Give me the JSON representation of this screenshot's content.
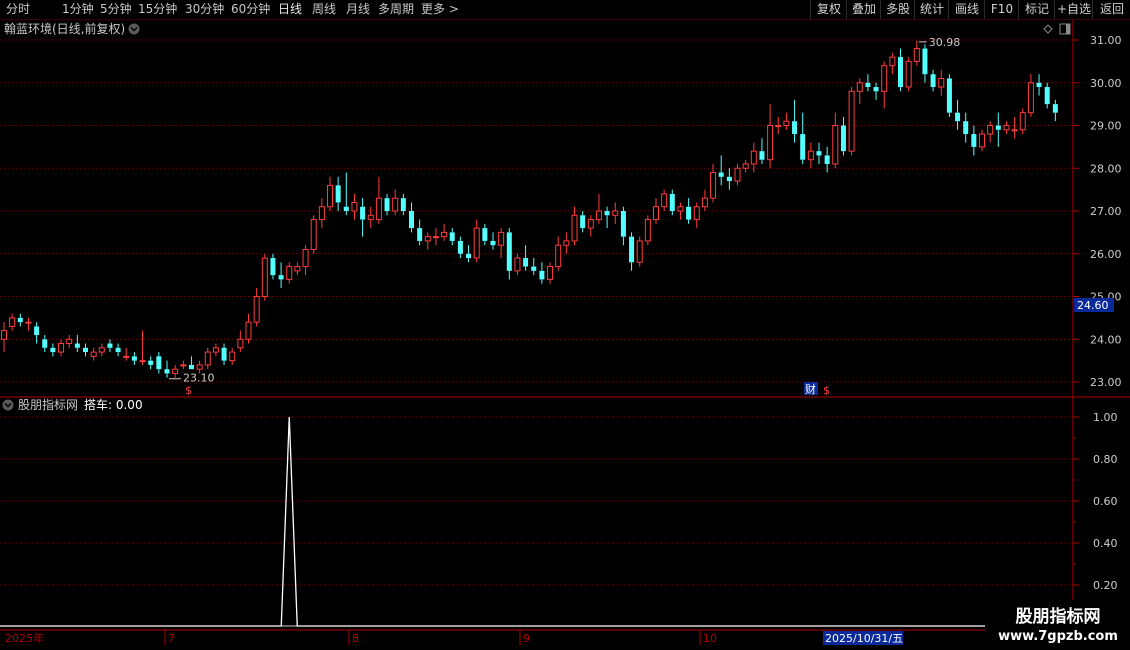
{
  "toolbar": {
    "periods": [
      {
        "label": "分时",
        "active": false
      },
      {
        "label": "1分钟",
        "active": false
      },
      {
        "label": "5分钟",
        "active": false
      },
      {
        "label": "15分钟",
        "active": false
      },
      {
        "label": "30分钟",
        "active": false
      },
      {
        "label": "60分钟",
        "active": false
      },
      {
        "label": "日线",
        "active": true
      },
      {
        "label": "周线",
        "active": false
      },
      {
        "label": "月线",
        "active": false
      },
      {
        "label": "多周期",
        "active": false
      },
      {
        "label": "更多 >",
        "active": false
      }
    ],
    "right_buttons": [
      "复权",
      "叠加",
      "多股",
      "统计",
      "画线",
      "F10",
      "标记",
      "+自选",
      "返回"
    ]
  },
  "colors": {
    "up": "#ff3c3c",
    "down": "#54ffff",
    "grid": "#7a0000",
    "axis": "#b00000",
    "price_tag_bg": "#0a2a9a",
    "date_tag_bg": "#0a2a9a",
    "text_yellow": "#d8c800"
  },
  "price_panel": {
    "title": "翰蓝环境(日线,前复权)",
    "high_marker": "30.98",
    "low_marker": "23.10",
    "current_price_tag": "24.60",
    "event_marker": "财",
    "dollar_marker": "$",
    "y_ticks": [
      "31.00",
      "30.00",
      "29.00",
      "28.00",
      "27.00",
      "26.00",
      "25.00",
      "24.00",
      "23.00"
    ]
  },
  "indicator_panel": {
    "title": "股朋指标网",
    "series_label": "搭车: 0.00",
    "y_ticks": [
      "1.00",
      "0.80",
      "0.60",
      "0.40",
      "0.20"
    ]
  },
  "time_axis": {
    "labels": [
      "2025年",
      "7",
      "8",
      "9",
      "10"
    ],
    "cursor_date": "2025/10/31/五"
  },
  "watermark": {
    "title": "股朋指标网",
    "url": "www.7gpzb.com"
  },
  "chart_data": [
    {
      "type": "candlestick",
      "title": "翰蓝环境(日线,前复权)",
      "ylim": [
        22.8,
        31.3
      ],
      "x_ticks": [
        "2025年",
        "7",
        "8",
        "9",
        "10"
      ],
      "ohlc": [
        [
          24.0,
          24.4,
          23.7,
          24.2
        ],
        [
          24.3,
          24.6,
          24.2,
          24.5
        ],
        [
          24.5,
          24.6,
          24.3,
          24.4
        ],
        [
          24.4,
          24.5,
          24.2,
          24.4
        ],
        [
          24.3,
          24.4,
          23.9,
          24.1
        ],
        [
          24.0,
          24.1,
          23.7,
          23.8
        ],
        [
          23.8,
          23.9,
          23.6,
          23.7
        ],
        [
          23.7,
          24.0,
          23.6,
          23.9
        ],
        [
          23.9,
          24.1,
          23.8,
          24.0
        ],
        [
          23.9,
          24.1,
          23.7,
          23.8
        ],
        [
          23.8,
          23.9,
          23.6,
          23.7
        ],
        [
          23.6,
          23.8,
          23.5,
          23.7
        ],
        [
          23.7,
          23.9,
          23.6,
          23.8
        ],
        [
          23.9,
          24.0,
          23.7,
          23.8
        ],
        [
          23.8,
          23.9,
          23.6,
          23.7
        ],
        [
          23.6,
          23.8,
          23.5,
          23.6
        ],
        [
          23.6,
          23.7,
          23.4,
          23.5
        ],
        [
          23.5,
          24.2,
          23.4,
          23.5
        ],
        [
          23.5,
          23.6,
          23.3,
          23.4
        ],
        [
          23.6,
          23.7,
          23.2,
          23.3
        ],
        [
          23.3,
          23.5,
          23.1,
          23.2
        ],
        [
          23.2,
          23.4,
          23.1,
          23.3
        ],
        [
          23.4,
          23.5,
          23.3,
          23.4
        ],
        [
          23.4,
          23.6,
          23.3,
          23.3
        ],
        [
          23.3,
          23.5,
          23.2,
          23.4
        ],
        [
          23.4,
          23.8,
          23.3,
          23.7
        ],
        [
          23.7,
          23.9,
          23.6,
          23.8
        ],
        [
          23.8,
          23.9,
          23.4,
          23.5
        ],
        [
          23.5,
          23.8,
          23.4,
          23.7
        ],
        [
          23.8,
          24.2,
          23.7,
          24.0
        ],
        [
          24.0,
          24.6,
          23.9,
          24.4
        ],
        [
          24.4,
          25.2,
          24.3,
          25.0
        ],
        [
          25.0,
          26.0,
          24.9,
          25.9
        ],
        [
          25.9,
          26.0,
          25.4,
          25.5
        ],
        [
          25.5,
          25.8,
          25.2,
          25.4
        ],
        [
          25.4,
          25.8,
          25.3,
          25.7
        ],
        [
          25.6,
          25.8,
          25.5,
          25.7
        ],
        [
          25.7,
          26.2,
          25.5,
          26.1
        ],
        [
          26.1,
          26.9,
          26.0,
          26.8
        ],
        [
          26.8,
          27.3,
          26.6,
          27.1
        ],
        [
          27.1,
          27.8,
          27.0,
          27.6
        ],
        [
          27.6,
          27.8,
          27.0,
          27.2
        ],
        [
          27.1,
          27.9,
          26.9,
          27.0
        ],
        [
          27.0,
          27.4,
          26.8,
          27.2
        ],
        [
          27.1,
          27.3,
          26.4,
          26.8
        ],
        [
          26.8,
          27.1,
          26.6,
          26.9
        ],
        [
          26.8,
          27.8,
          26.7,
          27.3
        ],
        [
          27.3,
          27.4,
          26.9,
          27.0
        ],
        [
          27.0,
          27.5,
          26.9,
          27.3
        ],
        [
          27.3,
          27.4,
          26.9,
          27.0
        ],
        [
          27.0,
          27.2,
          26.5,
          26.6
        ],
        [
          26.6,
          26.8,
          26.2,
          26.3
        ],
        [
          26.3,
          26.5,
          26.1,
          26.4
        ],
        [
          26.4,
          26.6,
          26.2,
          26.4
        ],
        [
          26.4,
          26.7,
          26.3,
          26.5
        ],
        [
          26.5,
          26.6,
          26.2,
          26.3
        ],
        [
          26.3,
          26.4,
          25.9,
          26.0
        ],
        [
          26.0,
          26.2,
          25.8,
          25.9
        ],
        [
          25.9,
          26.8,
          25.8,
          26.6
        ],
        [
          26.6,
          26.7,
          26.2,
          26.3
        ],
        [
          26.3,
          26.5,
          26.1,
          26.2
        ],
        [
          26.2,
          26.6,
          25.9,
          26.5
        ],
        [
          26.5,
          26.6,
          25.4,
          25.6
        ],
        [
          25.6,
          26.0,
          25.5,
          25.9
        ],
        [
          25.9,
          26.2,
          25.6,
          25.7
        ],
        [
          25.7,
          25.9,
          25.5,
          25.6
        ],
        [
          25.6,
          25.8,
          25.3,
          25.4
        ],
        [
          25.4,
          25.8,
          25.3,
          25.7
        ],
        [
          25.7,
          26.4,
          25.6,
          26.2
        ],
        [
          26.2,
          26.5,
          26.0,
          26.3
        ],
        [
          26.3,
          27.1,
          26.2,
          26.9
        ],
        [
          26.9,
          27.0,
          26.5,
          26.6
        ],
        [
          26.6,
          26.9,
          26.4,
          26.8
        ],
        [
          26.8,
          27.4,
          26.7,
          27.0
        ],
        [
          27.0,
          27.1,
          26.6,
          26.9
        ],
        [
          26.9,
          27.2,
          26.7,
          27.0
        ],
        [
          27.0,
          27.1,
          26.2,
          26.4
        ],
        [
          26.4,
          26.5,
          25.6,
          25.8
        ],
        [
          25.8,
          26.4,
          25.7,
          26.3
        ],
        [
          26.3,
          26.9,
          26.2,
          26.8
        ],
        [
          26.8,
          27.3,
          26.7,
          27.1
        ],
        [
          27.1,
          27.5,
          27.0,
          27.4
        ],
        [
          27.4,
          27.5,
          26.9,
          27.0
        ],
        [
          27.0,
          27.2,
          26.8,
          27.1
        ],
        [
          27.1,
          27.3,
          26.7,
          26.8
        ],
        [
          26.8,
          27.2,
          26.6,
          27.1
        ],
        [
          27.1,
          27.5,
          27.0,
          27.3
        ],
        [
          27.3,
          28.1,
          27.2,
          27.9
        ],
        [
          27.9,
          28.3,
          27.6,
          27.8
        ],
        [
          27.8,
          28.0,
          27.5,
          27.7
        ],
        [
          27.7,
          28.1,
          27.6,
          28.0
        ],
        [
          28.0,
          28.2,
          27.9,
          28.1
        ],
        [
          28.1,
          28.6,
          27.9,
          28.4
        ],
        [
          28.4,
          28.7,
          28.1,
          28.2
        ],
        [
          28.2,
          29.5,
          28.0,
          29.0
        ],
        [
          29.0,
          29.2,
          28.8,
          29.0
        ],
        [
          29.0,
          29.3,
          28.9,
          29.1
        ],
        [
          29.1,
          29.6,
          28.6,
          28.8
        ],
        [
          28.8,
          29.3,
          28.1,
          28.2
        ],
        [
          28.2,
          28.6,
          28.0,
          28.4
        ],
        [
          28.4,
          28.6,
          28.1,
          28.3
        ],
        [
          28.3,
          28.5,
          27.9,
          28.1
        ],
        [
          28.1,
          29.3,
          28.0,
          29.0
        ],
        [
          29.0,
          29.2,
          28.3,
          28.4
        ],
        [
          28.4,
          29.9,
          28.3,
          29.8
        ],
        [
          29.8,
          30.1,
          29.5,
          30.0
        ],
        [
          30.0,
          30.2,
          29.8,
          29.9
        ],
        [
          29.9,
          30.0,
          29.6,
          29.8
        ],
        [
          29.8,
          30.5,
          29.4,
          30.4
        ],
        [
          30.4,
          30.7,
          30.2,
          30.6
        ],
        [
          30.6,
          30.8,
          29.8,
          29.9
        ],
        [
          29.9,
          30.6,
          29.8,
          30.5
        ],
        [
          30.5,
          30.98,
          30.4,
          30.8
        ],
        [
          30.8,
          30.9,
          30.0,
          30.2
        ],
        [
          30.2,
          30.3,
          29.8,
          29.9
        ],
        [
          29.9,
          30.3,
          29.7,
          30.1
        ],
        [
          30.1,
          30.2,
          29.2,
          29.3
        ],
        [
          29.3,
          29.6,
          28.9,
          29.1
        ],
        [
          29.1,
          29.3,
          28.6,
          28.8
        ],
        [
          28.8,
          29.0,
          28.3,
          28.5
        ],
        [
          28.5,
          28.9,
          28.4,
          28.8
        ],
        [
          28.8,
          29.1,
          28.6,
          29.0
        ],
        [
          29.0,
          29.3,
          28.5,
          28.9
        ],
        [
          28.9,
          29.1,
          28.8,
          29.0
        ],
        [
          28.9,
          29.2,
          28.7,
          28.9
        ],
        [
          28.9,
          29.4,
          28.8,
          29.3
        ],
        [
          29.3,
          30.2,
          29.2,
          30.0
        ],
        [
          30.0,
          30.2,
          29.7,
          29.9
        ],
        [
          29.9,
          30.0,
          29.4,
          29.5
        ],
        [
          29.5,
          29.6,
          29.1,
          29.3
        ]
      ]
    },
    {
      "type": "line",
      "title": "股朋指标网",
      "series": [
        {
          "name": "搭车",
          "spike_index": 35,
          "spike_value": 1.0,
          "baseline": 0.0
        }
      ],
      "ylim": [
        0.0,
        1.05
      ]
    }
  ]
}
